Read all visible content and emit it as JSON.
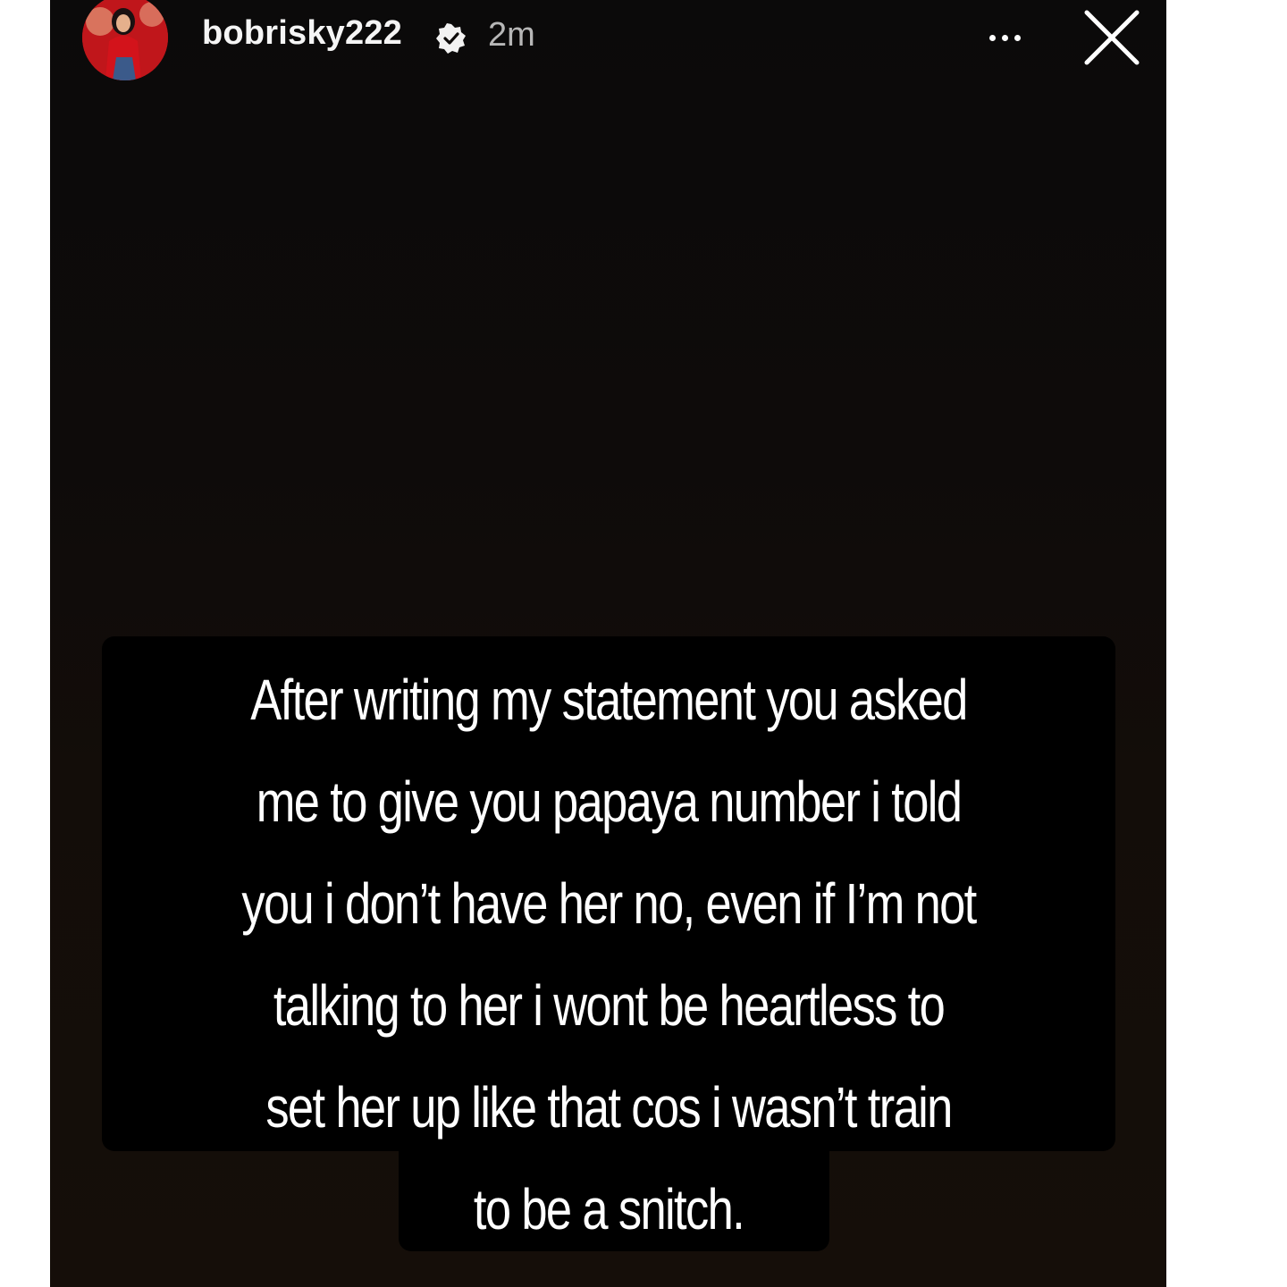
{
  "story": {
    "username": "bobrisky222",
    "time_ago": "2m",
    "caption_lines": [
      "After writing my statement you asked",
      "me to give you papaya number i told",
      "you i don’t have her no, even if I’m not",
      "talking to her i wont be heartless to",
      "set her up like that cos i wasn’t train",
      "to be a snitch."
    ]
  },
  "icons": {
    "verified": "verified-badge-icon",
    "more": "more-options-icon",
    "close": "close-icon"
  },
  "colors": {
    "background": "#0e0b0a",
    "caption_box": "#000000",
    "text": "#ffffff",
    "time": "#b7b7b7"
  }
}
